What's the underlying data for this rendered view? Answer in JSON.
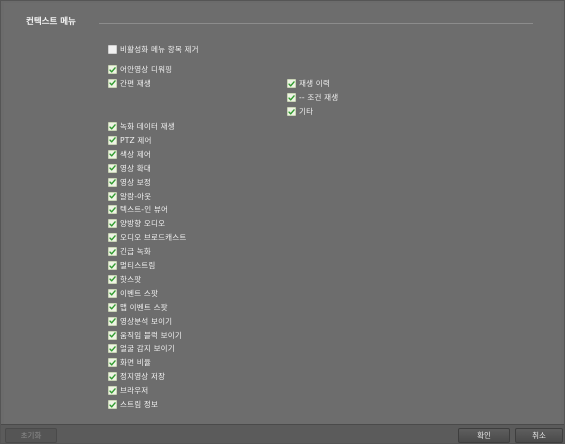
{
  "section": {
    "title": "컨텍스트 메뉴"
  },
  "disable_option": {
    "label": "비활성화 메뉴 항목 제거",
    "checked": false
  },
  "left_items": [
    {
      "label": "어안영상 디워핑",
      "checked": true
    },
    {
      "label": "간편 재생",
      "checked": true
    },
    {
      "label": "녹화 데이터 재생",
      "checked": true
    },
    {
      "label": "PTZ 제어",
      "checked": true
    },
    {
      "label": "색상 제어",
      "checked": true
    },
    {
      "label": "영상 확대",
      "checked": true
    },
    {
      "label": "영상 보정",
      "checked": true
    },
    {
      "label": "알람-아웃",
      "checked": true
    },
    {
      "label": "텍스트-인 뷰어",
      "checked": true
    },
    {
      "label": "양방향 오디오",
      "checked": true
    },
    {
      "label": "오디오 브로드캐스트",
      "checked": true
    },
    {
      "label": "긴급 녹화",
      "checked": true
    },
    {
      "label": "멀티스트림",
      "checked": true
    },
    {
      "label": "핫스팟",
      "checked": true
    },
    {
      "label": "이벤트 스팟",
      "checked": true
    },
    {
      "label": "맵 이벤트 스팟",
      "checked": true
    },
    {
      "label": "영상분석 보이기",
      "checked": true
    },
    {
      "label": "움직임 블럭 보이기",
      "checked": true
    },
    {
      "label": "얼굴 감지 보이기",
      "checked": true
    },
    {
      "label": "화면 비율",
      "checked": true
    },
    {
      "label": "정지영상 저장",
      "checked": true
    },
    {
      "label": "브라우저",
      "checked": true
    },
    {
      "label": "스트림 정보",
      "checked": true
    }
  ],
  "right_items": [
    {
      "label": "재생 이력",
      "checked": true
    },
    {
      "label": "-- 조건 재생",
      "checked": true
    },
    {
      "label": "기타",
      "checked": true
    }
  ],
  "footer": {
    "reset_label": "초기화",
    "ok_label": "확인",
    "cancel_label": "취소"
  }
}
